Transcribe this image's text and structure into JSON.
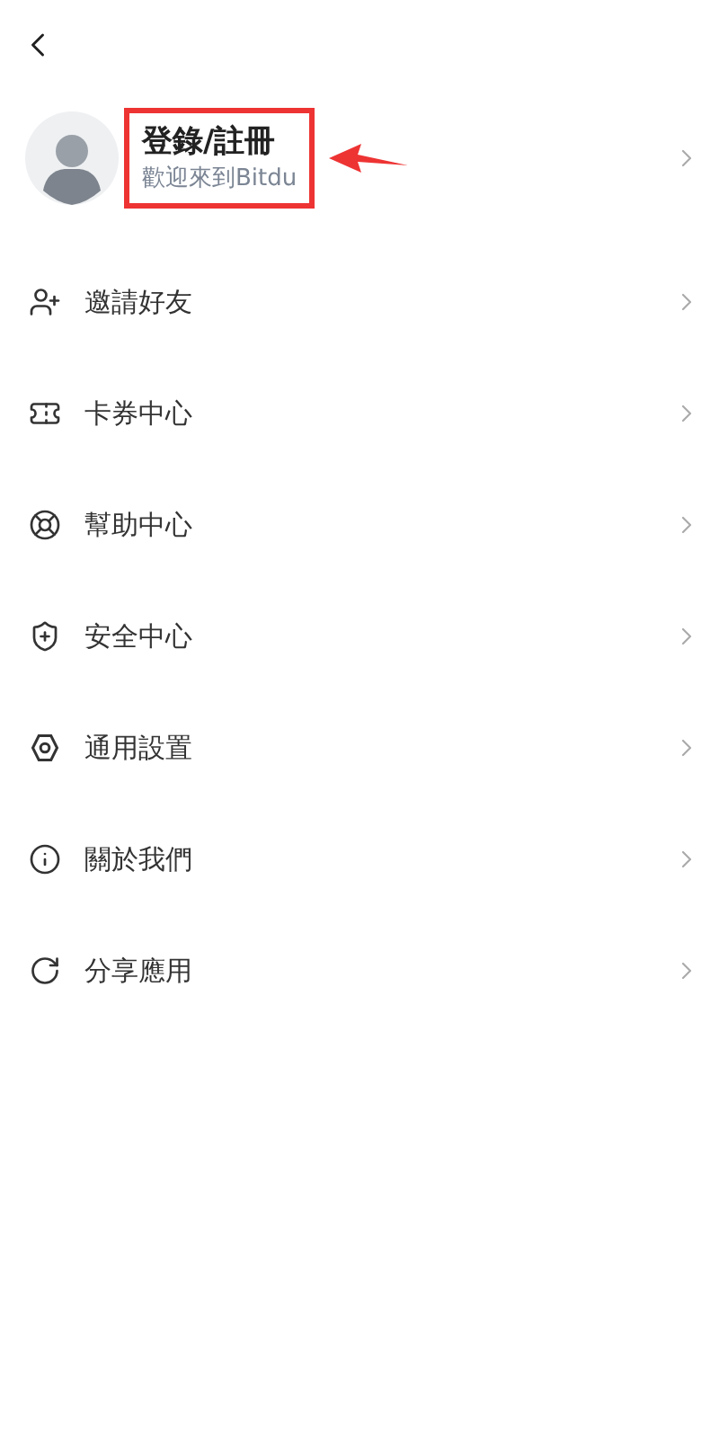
{
  "profile": {
    "title": "登錄/註冊",
    "subtitle": "歡迎來到Bitdu",
    "highlighted": true
  },
  "menu": [
    {
      "kind": "invite",
      "label": "邀請好友"
    },
    {
      "kind": "coupon",
      "label": "卡券中心"
    },
    {
      "kind": "help",
      "label": "幫助中心"
    },
    {
      "kind": "security",
      "label": "安全中心"
    },
    {
      "kind": "settings",
      "label": "通用設置"
    },
    {
      "kind": "about",
      "label": "關於我們"
    },
    {
      "kind": "share",
      "label": "分享應用"
    }
  ]
}
